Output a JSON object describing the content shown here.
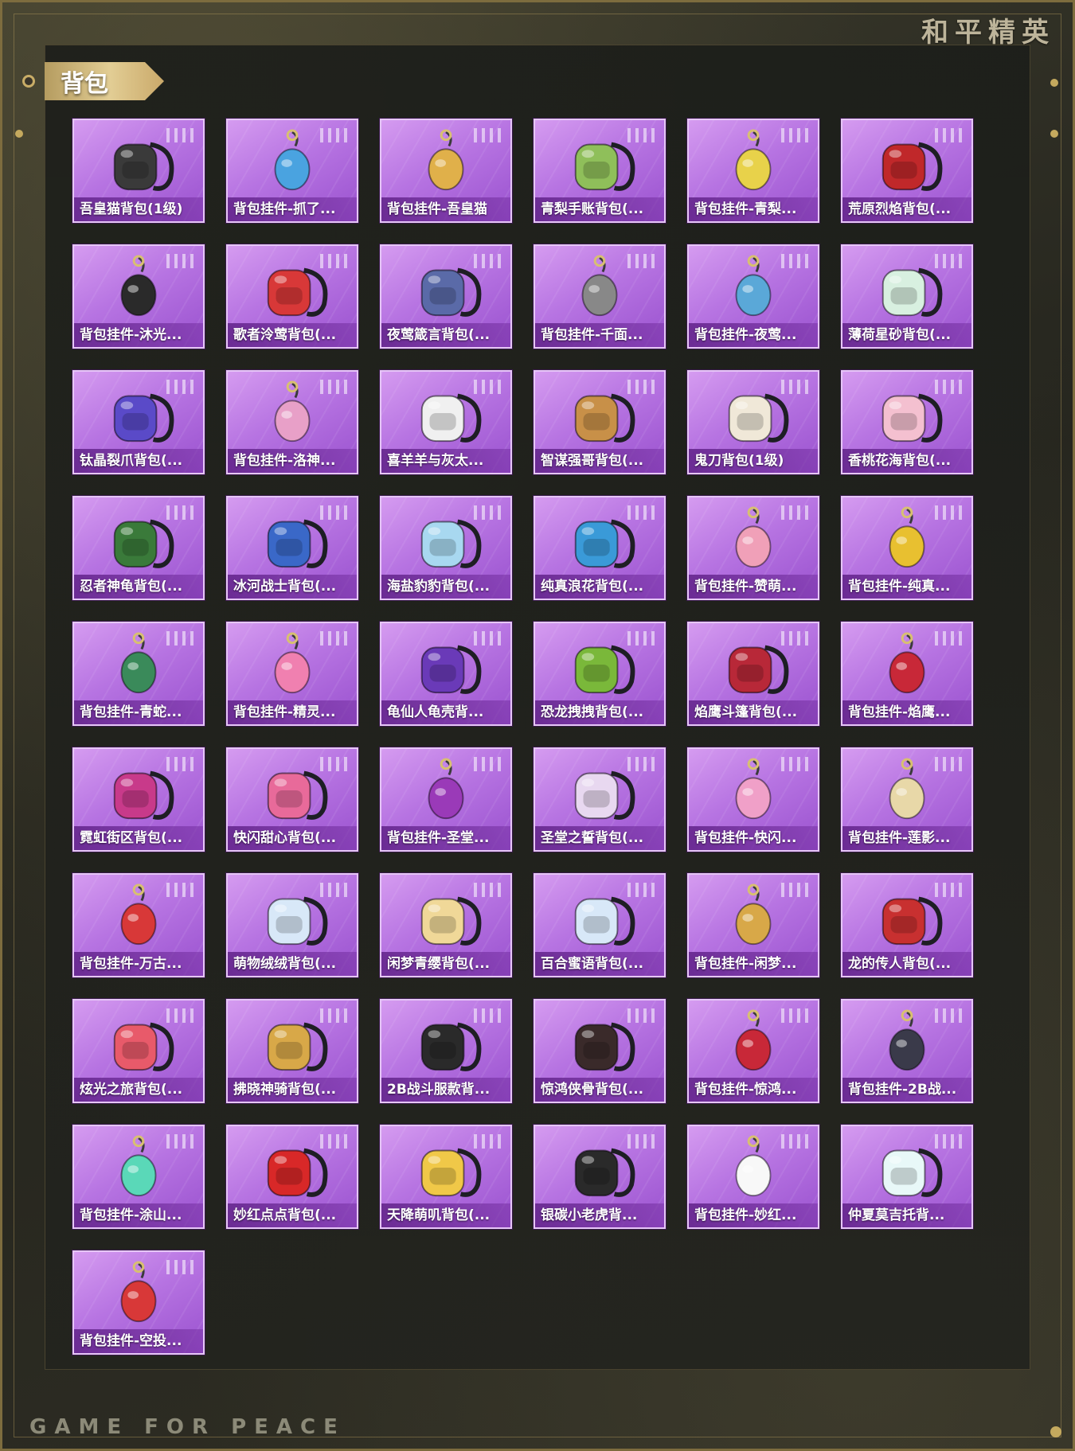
{
  "brand": {
    "top": "和平精英",
    "bottom": "GAME FOR PEACE"
  },
  "section": {
    "title": "背包"
  },
  "items": [
    {
      "name": "吾皇猫背包(1级)",
      "icon": "cat-backpack-icon",
      "color": "#3a3a3a"
    },
    {
      "name": "背包挂件-抓了...",
      "icon": "anchor-charm-icon",
      "color": "#4aa3e0"
    },
    {
      "name": "背包挂件-吾皇猫",
      "icon": "cat-charm-icon",
      "color": "#e0b04a"
    },
    {
      "name": "青梨手账背包(...",
      "icon": "snail-backpack-icon",
      "color": "#8fbf5a"
    },
    {
      "name": "背包挂件-青梨...",
      "icon": "pear-charm-icon",
      "color": "#e8d24a"
    },
    {
      "name": "荒原烈焰背包(...",
      "icon": "flame-backpack-icon",
      "color": "#c0282a"
    },
    {
      "name": "背包挂件-沐光...",
      "icon": "dog-charm-icon",
      "color": "#2a2a2a"
    },
    {
      "name": "歌者泠莺背包(...",
      "icon": "pouch-backpack-icon",
      "color": "#d83838"
    },
    {
      "name": "夜莺箴言背包(...",
      "icon": "key-backpack-icon",
      "color": "#5a6aa8"
    },
    {
      "name": "背包挂件-千面...",
      "icon": "gem-charm-icon",
      "color": "#888888"
    },
    {
      "name": "背包挂件-夜莺...",
      "icon": "bird-charm-icon",
      "color": "#5aa8d8"
    },
    {
      "name": "薄荷星砂背包(...",
      "icon": "mint-bag-icon",
      "color": "#d8f0e0"
    },
    {
      "name": "钛晶裂爪背包(...",
      "icon": "crystal-backpack-icon",
      "color": "#5a4ac8"
    },
    {
      "name": "背包挂件-洛神...",
      "icon": "bow-charm-icon",
      "color": "#e8a0c8"
    },
    {
      "name": "喜羊羊与灰太...",
      "icon": "sheep-backpack-icon",
      "color": "#f0f0f0"
    },
    {
      "name": "智谋强哥背包(...",
      "icon": "bear-backpack-icon",
      "color": "#c89048"
    },
    {
      "name": "鬼刀背包(1级)",
      "icon": "ghost-blade-backpack-icon",
      "color": "#f0e8d8"
    },
    {
      "name": "香桃花海背包(...",
      "icon": "peach-backpack-icon",
      "color": "#f4c0d0"
    },
    {
      "name": "忍者神龟背包(...",
      "icon": "turtle-backpack-icon",
      "color": "#3a7a3a"
    },
    {
      "name": "冰河战士背包(...",
      "icon": "ice-backpack-icon",
      "color": "#3a68c8"
    },
    {
      "name": "海盐豹豹背包(...",
      "icon": "seal-backpack-icon",
      "color": "#a8d8f0"
    },
    {
      "name": "纯真浪花背包(...",
      "icon": "cup-backpack-icon",
      "color": "#3a9ad8"
    },
    {
      "name": "背包挂件-赞萌...",
      "icon": "pig-charm-icon",
      "color": "#f0a0b8"
    },
    {
      "name": "背包挂件-纯真...",
      "icon": "key-charm-icon",
      "color": "#e8c030"
    },
    {
      "name": "背包挂件-青蛇...",
      "icon": "snake-charm-icon",
      "color": "#3a8a5a"
    },
    {
      "name": "背包挂件-精灵...",
      "icon": "wing-heart-charm-icon",
      "color": "#f080b0"
    },
    {
      "name": "龟仙人龟壳背...",
      "icon": "shell-backpack-icon",
      "color": "#6a3ab8"
    },
    {
      "name": "恐龙拽拽背包(...",
      "icon": "dino-backpack-icon",
      "color": "#7ab83a"
    },
    {
      "name": "焰鹰斗篷背包(...",
      "icon": "hawk-backpack-icon",
      "color": "#b82838"
    },
    {
      "name": "背包挂件-焰鹰...",
      "icon": "tassel-charm-icon",
      "color": "#c82838"
    },
    {
      "name": "霓虹街区背包(...",
      "icon": "neon-backpack-icon",
      "color": "#c83a8a"
    },
    {
      "name": "快闪甜心背包(...",
      "icon": "camera-backpack-icon",
      "color": "#e86a9a"
    },
    {
      "name": "背包挂件-圣堂...",
      "icon": "orb-charm-icon",
      "color": "#9a3ab8"
    },
    {
      "name": "圣堂之誓背包(...",
      "icon": "heart-backpack-icon",
      "color": "#e8d8f0"
    },
    {
      "name": "背包挂件-快闪...",
      "icon": "donut-charm-icon",
      "color": "#f0a0c8"
    },
    {
      "name": "背包挂件-莲影...",
      "icon": "sword-charm-icon",
      "color": "#e8d8a8"
    },
    {
      "name": "背包挂件-万古...",
      "icon": "blade-charm-icon",
      "color": "#d83838"
    },
    {
      "name": "萌物绒绒背包(...",
      "icon": "bunny-backpack-icon",
      "color": "#d8e8f8"
    },
    {
      "name": "闲梦青缨背包(...",
      "icon": "shell-pouch-backpack-icon",
      "color": "#f0d898"
    },
    {
      "name": "百合蜜语背包(...",
      "icon": "lily-backpack-icon",
      "color": "#d8e8f8"
    },
    {
      "name": "背包挂件-闲梦...",
      "icon": "fan-charm-icon",
      "color": "#d8a848"
    },
    {
      "name": "龙的传人背包(...",
      "icon": "dragon-backpack-icon",
      "color": "#c83030"
    },
    {
      "name": "炫光之旅背包(...",
      "icon": "arcade-backpack-icon",
      "color": "#e85a6a"
    },
    {
      "name": "拂晓神骑背包(...",
      "icon": "knight-backpack-icon",
      "color": "#d8a848"
    },
    {
      "name": "2B战斗服款背...",
      "icon": "dark-backpack-icon",
      "color": "#2a2a2a"
    },
    {
      "name": "惊鸿侠骨背包(...",
      "icon": "armor-backpack-icon",
      "color": "#3a2a2a"
    },
    {
      "name": "背包挂件-惊鸿...",
      "icon": "red-tassel-charm-icon",
      "color": "#c82838"
    },
    {
      "name": "背包挂件-2B战...",
      "icon": "scythe-charm-icon",
      "color": "#3a3a4a"
    },
    {
      "name": "背包挂件-涂山...",
      "icon": "fox-tail-charm-icon",
      "color": "#5ad8b8"
    },
    {
      "name": "妙红点点背包(...",
      "icon": "ladybug-backpack-icon",
      "color": "#d82828"
    },
    {
      "name": "天降萌叽背包(...",
      "icon": "yellow-backpack-icon",
      "color": "#f0c848"
    },
    {
      "name": "银碳小老虎背...",
      "icon": "tiger-backpack-icon",
      "color": "#2a2a2a"
    },
    {
      "name": "背包挂件-妙红...",
      "icon": "daisy-charm-icon",
      "color": "#f8f8f8"
    },
    {
      "name": "仲夏莫吉托背...",
      "icon": "mojito-backpack-icon",
      "color": "#e8f8f8"
    },
    {
      "name": "背包挂件-空投...",
      "icon": "airdrop-charm-icon",
      "color": "#d83838"
    }
  ]
}
